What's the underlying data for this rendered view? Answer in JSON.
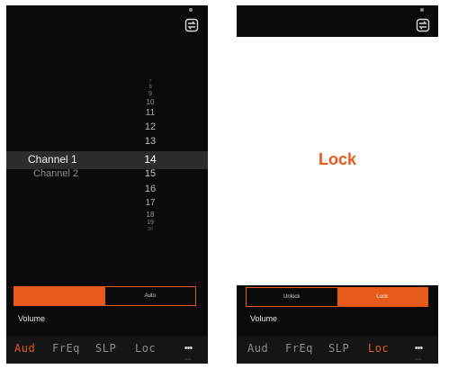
{
  "left_screen": {
    "channels": [
      "Channel 1",
      "Channel 2"
    ],
    "selected_channel": "Channel 1",
    "numbers": [
      "7",
      "8",
      "9",
      "10",
      "11",
      "12",
      "13",
      "14",
      "15",
      "16",
      "17",
      "18",
      "19",
      "20"
    ],
    "selected_number": "14",
    "segment": {
      "left_label": "",
      "right_label": "Auto",
      "active": "left"
    },
    "volume_label": "Volume",
    "tabs": [
      {
        "label": "Aud",
        "active": true
      },
      {
        "label": "FrEq",
        "active": false
      },
      {
        "label": "SLP",
        "active": false
      },
      {
        "label": "Loc",
        "active": false
      }
    ],
    "more_label": "•••",
    "more_sub": "More"
  },
  "right_screen": {
    "lock_title": "Lock",
    "segment": {
      "left_label": "Unlock",
      "right_label": "Lock",
      "active": "right"
    },
    "volume_label": "Volume",
    "tabs": [
      {
        "label": "Aud",
        "active": false
      },
      {
        "label": "FrEq",
        "active": false
      },
      {
        "label": "SLP",
        "active": false
      },
      {
        "label": "Loc",
        "active": true
      }
    ],
    "more_label": "•••",
    "more_sub": "More"
  },
  "colors": {
    "accent": "#e85a1a",
    "background": "#0a0a0a",
    "picker_band": "#2c2c2c"
  },
  "icons": [
    "sync-icon"
  ]
}
